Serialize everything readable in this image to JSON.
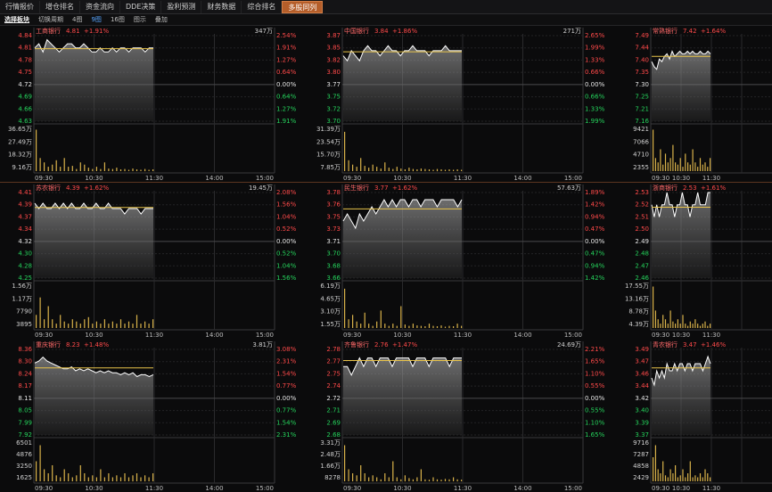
{
  "tabs": [
    {
      "label": "行情报价",
      "active": false
    },
    {
      "label": "增仓排名",
      "active": false
    },
    {
      "label": "资金流向",
      "active": false
    },
    {
      "label": "DDE决策",
      "active": false
    },
    {
      "label": "盈利预测",
      "active": false
    },
    {
      "label": "财务数据",
      "active": false
    },
    {
      "label": "综合排名",
      "active": false
    },
    {
      "label": "多股同列",
      "active": true
    }
  ],
  "toolbar": {
    "items": [
      "选择板块",
      "切换周期",
      "4图",
      "9图",
      "16图",
      "图示",
      "叠加"
    ],
    "active_index": 3
  },
  "time_labels": [
    "09:30",
    "10:30",
    "11:30",
    "14:00",
    "15:00"
  ],
  "colors": {
    "up": "#ff4a4a",
    "down": "#25d35c",
    "flat": "#e6e6e6",
    "price_line": "#ffffff",
    "avg_line": "#e8c34a",
    "volume": "#d9b24a",
    "name": "#ff6a6a"
  },
  "panels": [
    {
      "name": "工商银行",
      "price": "4.81",
      "change": "+1.91%",
      "vol_label": "347万",
      "price_ticks": [
        "4.84",
        "4.81",
        "4.78",
        "4.75",
        "4.72",
        "4.69",
        "4.66",
        "4.63"
      ],
      "pct_ticks": [
        "2.54%",
        "1.91%",
        "1.27%",
        "0.64%",
        "0.00%",
        "0.64%",
        "1.27%",
        "1.91%"
      ],
      "vol_ticks": [
        "36.65万",
        "27.49万",
        "18.32万",
        "9.16万"
      ],
      "series": [
        4.81,
        4.82,
        4.8,
        4.83,
        4.82,
        4.81,
        4.8,
        4.81,
        4.82,
        4.82,
        4.81,
        4.81,
        4.82,
        4.81,
        4.8,
        4.8,
        4.81,
        4.8,
        4.8,
        4.81,
        4.8,
        4.81,
        4.81,
        4.8,
        4.81,
        4.81,
        4.81,
        4.8,
        4.81,
        4.81
      ],
      "avg": 4.808,
      "volumes": [
        0.95,
        0.3,
        0.2,
        0.1,
        0.15,
        0.25,
        0.1,
        0.3,
        0.1,
        0.12,
        0.05,
        0.2,
        0.15,
        0.08,
        0.05,
        0.1,
        0.05,
        0.2,
        0.06,
        0.05,
        0.08,
        0.04,
        0.05,
        0.03,
        0.06,
        0.04,
        0.03,
        0.05,
        0.03,
        0.04
      ]
    },
    {
      "name": "中国银行",
      "price": "3.84",
      "change": "+1.86%",
      "vol_label": "271万",
      "price_ticks": [
        "3.87",
        "3.85",
        "3.82",
        "3.80",
        "3.77",
        "3.75",
        "3.72",
        "3.70"
      ],
      "pct_ticks": [
        "2.65%",
        "1.99%",
        "1.33%",
        "0.66%",
        "0.00%",
        "0.66%",
        "1.33%",
        "1.99%"
      ],
      "vol_ticks": [
        "31.39万",
        "23.54万",
        "15.70万",
        "7.85万"
      ],
      "series": [
        3.83,
        3.82,
        3.84,
        3.83,
        3.82,
        3.84,
        3.85,
        3.84,
        3.84,
        3.83,
        3.84,
        3.85,
        3.84,
        3.84,
        3.83,
        3.84,
        3.84,
        3.85,
        3.84,
        3.84,
        3.84,
        3.83,
        3.84,
        3.84,
        3.84,
        3.85,
        3.84,
        3.84,
        3.84,
        3.84
      ],
      "avg": 3.838,
      "volumes": [
        0.9,
        0.25,
        0.15,
        0.1,
        0.3,
        0.12,
        0.08,
        0.15,
        0.1,
        0.06,
        0.2,
        0.08,
        0.05,
        0.1,
        0.06,
        0.04,
        0.08,
        0.05,
        0.04,
        0.06,
        0.05,
        0.04,
        0.03,
        0.05,
        0.04,
        0.03,
        0.04,
        0.03,
        0.04,
        0.03
      ]
    },
    {
      "name": "常熟银行",
      "price": "7.42",
      "change": "+1.64%",
      "vol_label": "",
      "price_ticks": [
        "7.49",
        "7.44",
        "7.40",
        "7.35",
        "7.30",
        "7.25",
        "7.21",
        "7.16"
      ],
      "pct_ticks": [],
      "vol_ticks": [
        "9421",
        "7066",
        "4710",
        "2355"
      ],
      "series": [
        7.39,
        7.37,
        7.36,
        7.4,
        7.39,
        7.41,
        7.42,
        7.4,
        7.43,
        7.41,
        7.42,
        7.43,
        7.42,
        7.42,
        7.43,
        7.42,
        7.43,
        7.42,
        7.42,
        7.43,
        7.42,
        7.42,
        7.43,
        7.42
      ],
      "avg": 7.41,
      "volumes": [
        0.95,
        0.3,
        0.2,
        0.5,
        0.15,
        0.4,
        0.2,
        0.3,
        0.6,
        0.2,
        0.15,
        0.3,
        0.1,
        0.4,
        0.2,
        0.15,
        0.5,
        0.2,
        0.1,
        0.3,
        0.15,
        0.2,
        0.1,
        0.3
      ]
    },
    {
      "name": "苏农银行",
      "price": "4.39",
      "change": "+1.62%",
      "vol_label": "19.45万",
      "price_ticks": [
        "4.41",
        "4.39",
        "4.37",
        "4.34",
        "4.32",
        "4.30",
        "4.28",
        "4.25"
      ],
      "pct_ticks": [
        "2.08%",
        "1.56%",
        "1.04%",
        "0.52%",
        "0.00%",
        "0.52%",
        "1.04%",
        "1.56%"
      ],
      "vol_ticks": [
        "1.56万",
        "1.17万",
        "7790",
        "3895"
      ],
      "series": [
        4.39,
        4.38,
        4.39,
        4.38,
        4.38,
        4.39,
        4.38,
        4.39,
        4.38,
        4.39,
        4.38,
        4.38,
        4.39,
        4.38,
        4.38,
        4.39,
        4.38,
        4.38,
        4.39,
        4.38,
        4.38,
        4.38,
        4.37,
        4.38,
        4.38,
        4.38,
        4.37,
        4.38,
        4.38,
        4.38
      ],
      "avg": 4.382,
      "volumes": [
        0.3,
        0.7,
        0.2,
        0.5,
        0.2,
        0.1,
        0.3,
        0.15,
        0.1,
        0.2,
        0.15,
        0.1,
        0.2,
        0.25,
        0.1,
        0.15,
        0.1,
        0.2,
        0.1,
        0.15,
        0.1,
        0.2,
        0.1,
        0.15,
        0.1,
        0.3,
        0.1,
        0.15,
        0.1,
        0.2
      ]
    },
    {
      "name": "民生银行",
      "price": "3.77",
      "change": "+1.62%",
      "vol_label": "57.63万",
      "price_ticks": [
        "3.78",
        "3.76",
        "3.75",
        "3.73",
        "3.71",
        "3.70",
        "3.68",
        "3.66"
      ],
      "pct_ticks": [
        "1.89%",
        "1.42%",
        "0.94%",
        "0.47%",
        "0.00%",
        "0.47%",
        "0.94%",
        "1.42%"
      ],
      "vol_ticks": [
        "6.19万",
        "4.65万",
        "3.10万",
        "1.55万"
      ],
      "series": [
        3.74,
        3.75,
        3.74,
        3.73,
        3.75,
        3.74,
        3.75,
        3.76,
        3.75,
        3.76,
        3.77,
        3.76,
        3.77,
        3.76,
        3.77,
        3.77,
        3.76,
        3.77,
        3.77,
        3.76,
        3.77,
        3.77,
        3.77,
        3.76,
        3.77,
        3.77,
        3.77,
        3.77,
        3.76,
        3.77
      ],
      "avg": 3.757,
      "volumes": [
        0.9,
        0.2,
        0.3,
        0.15,
        0.1,
        0.35,
        0.1,
        0.05,
        0.15,
        0.4,
        0.1,
        0.05,
        0.1,
        0.05,
        0.5,
        0.08,
        0.05,
        0.1,
        0.06,
        0.05,
        0.04,
        0.1,
        0.05,
        0.04,
        0.06,
        0.03,
        0.05,
        0.04,
        0.1,
        0.05
      ]
    },
    {
      "name": "浙商银行",
      "price": "2.53",
      "change": "+1.61%",
      "vol_label": "",
      "price_ticks": [
        "2.53",
        "2.52",
        "2.51",
        "2.50",
        "2.49",
        "2.48",
        "2.47",
        "2.46"
      ],
      "pct_ticks": [],
      "vol_ticks": [
        "17.55万",
        "13.16万",
        "8.78万",
        "4.39万"
      ],
      "series": [
        2.52,
        2.51,
        2.52,
        2.51,
        2.52,
        2.52,
        2.53,
        2.52,
        2.52,
        2.51,
        2.52,
        2.52,
        2.53,
        2.52,
        2.52,
        2.51,
        2.52,
        2.52,
        2.53,
        2.52,
        2.52,
        2.52,
        2.53,
        2.53
      ],
      "avg": 2.518,
      "volumes": [
        0.95,
        0.4,
        0.2,
        0.1,
        0.3,
        0.2,
        0.1,
        0.4,
        0.15,
        0.1,
        0.2,
        0.1,
        0.3,
        0.1,
        0.05,
        0.15,
        0.1,
        0.2,
        0.1,
        0.05,
        0.1,
        0.15,
        0.05,
        0.1
      ]
    },
    {
      "name": "重庆银行",
      "price": "8.23",
      "change": "+1.48%",
      "vol_label": "3.81万",
      "price_ticks": [
        "8.36",
        "8.30",
        "8.24",
        "8.17",
        "8.11",
        "8.05",
        "7.99",
        "7.92"
      ],
      "pct_ticks": [
        "3.08%",
        "2.31%",
        "1.54%",
        "0.77%",
        "0.00%",
        "0.77%",
        "1.54%",
        "2.31%"
      ],
      "vol_ticks": [
        "6501",
        "4876",
        "3250",
        "1625"
      ],
      "series": [
        8.29,
        8.3,
        8.32,
        8.3,
        8.29,
        8.28,
        8.27,
        8.26,
        8.26,
        8.27,
        8.25,
        8.26,
        8.25,
        8.26,
        8.25,
        8.24,
        8.25,
        8.24,
        8.25,
        8.24,
        8.24,
        8.23,
        8.24,
        8.23,
        8.24,
        8.22,
        8.23,
        8.23,
        8.22,
        8.23
      ],
      "avg": 8.265,
      "volumes": [
        0.5,
        0.9,
        0.3,
        0.2,
        0.4,
        0.15,
        0.1,
        0.3,
        0.2,
        0.1,
        0.15,
        0.4,
        0.2,
        0.1,
        0.15,
        0.1,
        0.3,
        0.1,
        0.2,
        0.1,
        0.15,
        0.1,
        0.2,
        0.1,
        0.15,
        0.2,
        0.1,
        0.15,
        0.1,
        0.2
      ]
    },
    {
      "name": "齐鲁银行",
      "price": "2.76",
      "change": "+1.47%",
      "vol_label": "24.69万",
      "price_ticks": [
        "2.78",
        "2.77",
        "2.75",
        "2.74",
        "2.72",
        "2.71",
        "2.69",
        "2.68"
      ],
      "pct_ticks": [
        "2.21%",
        "1.65%",
        "1.10%",
        "0.55%",
        "0.00%",
        "0.55%",
        "1.10%",
        "1.65%"
      ],
      "vol_ticks": [
        "3.31万",
        "2.48万",
        "1.66万",
        "8278"
      ],
      "series": [
        2.76,
        2.76,
        2.75,
        2.76,
        2.77,
        2.76,
        2.77,
        2.77,
        2.76,
        2.77,
        2.77,
        2.77,
        2.76,
        2.77,
        2.77,
        2.77,
        2.77,
        2.76,
        2.77,
        2.77,
        2.77,
        2.76,
        2.77,
        2.77,
        2.77,
        2.77,
        2.76,
        2.77,
        2.77,
        2.77
      ],
      "avg": 2.767,
      "volumes": [
        0.9,
        0.3,
        0.2,
        0.15,
        0.4,
        0.2,
        0.1,
        0.15,
        0.1,
        0.05,
        0.2,
        0.1,
        0.5,
        0.1,
        0.05,
        0.15,
        0.08,
        0.05,
        0.1,
        0.3,
        0.05,
        0.04,
        0.1,
        0.05,
        0.04,
        0.06,
        0.05,
        0.1,
        0.05,
        0.04
      ]
    },
    {
      "name": "青农银行",
      "price": "3.47",
      "change": "+1.46%",
      "vol_label": "",
      "price_ticks": [
        "3.49",
        "3.47",
        "3.46",
        "3.44",
        "3.42",
        "3.40",
        "3.39",
        "3.37"
      ],
      "pct_ticks": [],
      "vol_ticks": [
        "9716",
        "7287",
        "4858",
        "2429"
      ],
      "series": [
        3.45,
        3.44,
        3.46,
        3.45,
        3.46,
        3.45,
        3.47,
        3.46,
        3.46,
        3.47,
        3.46,
        3.47,
        3.47,
        3.46,
        3.47,
        3.47,
        3.46,
        3.47,
        3.47,
        3.47,
        3.46,
        3.47,
        3.48,
        3.47
      ],
      "avg": 3.464,
      "volumes": [
        0.6,
        0.9,
        0.3,
        0.2,
        0.5,
        0.15,
        0.1,
        0.3,
        0.2,
        0.4,
        0.1,
        0.15,
        0.3,
        0.1,
        0.2,
        0.5,
        0.1,
        0.15,
        0.1,
        0.2,
        0.1,
        0.3,
        0.2,
        0.1
      ]
    }
  ]
}
